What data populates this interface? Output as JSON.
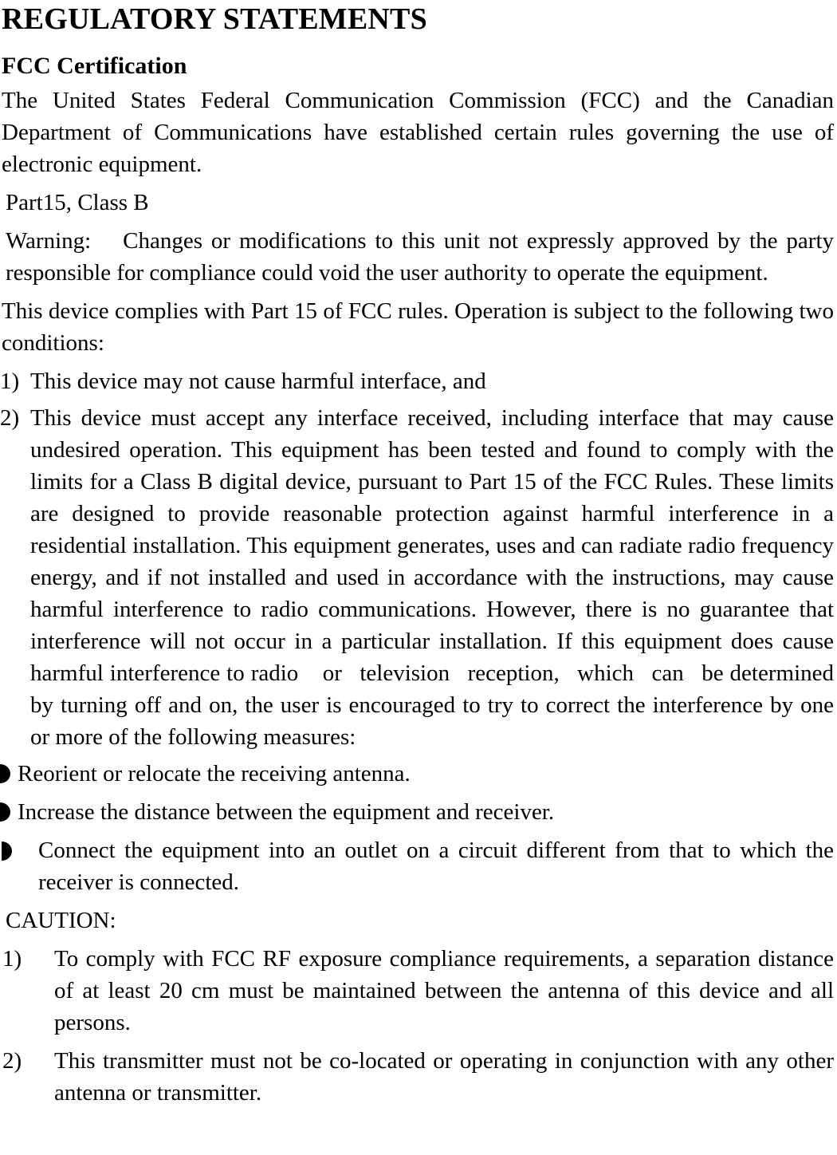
{
  "document": {
    "title": "REGULATORY STATEMENTS",
    "section_heading": "FCC Certification",
    "intro_paragraph": "The United States Federal Communication Commission (FCC) and the Canadian Department of Communications have established certain rules governing the use of electronic equipment.",
    "part_class_line": "Part15, Class B",
    "warning_paragraph": "Warning:  Changes or modifications to this unit not expressly approved by the party responsible for compliance could void the user authority to operate the equipment.",
    "compliance_paragraph": "This device complies with Part 15 of FCC rules. Operation is subject to the following two conditions:",
    "conditions": [
      {
        "marker": "1)",
        "text": "This device may not cause harmful interface, and"
      },
      {
        "marker": "2)",
        "text": "This device must accept any interface received, including interface that may cause undesired operation. This equipment has been tested and found to comply with the limits for a Class B digital device, pursuant to Part 15 of the FCC Rules. These limits are designed to provide reasonable protection against harmful interference in a residential installation. This equipment generates, uses and can radiate radio frequency energy, and if not installed and used in accordance with the instructions, may cause harmful interference to radio communications. However, there is no guarantee that interference will not occur in a particular installation. If this equipment does cause harmful interference to radio   or  television  reception,  which  can  be determined by turning off and on, the user is encouraged to try to correct the interference by one or more of the following measures:"
      }
    ],
    "measures": [
      {
        "bullet_icon": "filled-half-disc-bullet",
        "text": "Reorient or relocate the receiving antenna."
      },
      {
        "bullet_icon": "filled-half-disc-bullet",
        "text": "Increase the distance between the equipment and receiver."
      },
      {
        "bullet_icon": "filled-half-disc-bullet",
        "text": "Connect the equipment into an outlet on a circuit different from that to which the receiver is connected."
      }
    ],
    "caution_label": "CAUTION:",
    "caution_items": [
      {
        "marker": "1)",
        "text": "To comply with FCC RF exposure compliance requirements, a separation distance of at least 20 cm must be maintained between the antenna of this device and all persons."
      },
      {
        "marker": "2)",
        "text": "This transmitter must not be co-located or operating in conjunction with any other antenna or transmitter."
      }
    ]
  }
}
